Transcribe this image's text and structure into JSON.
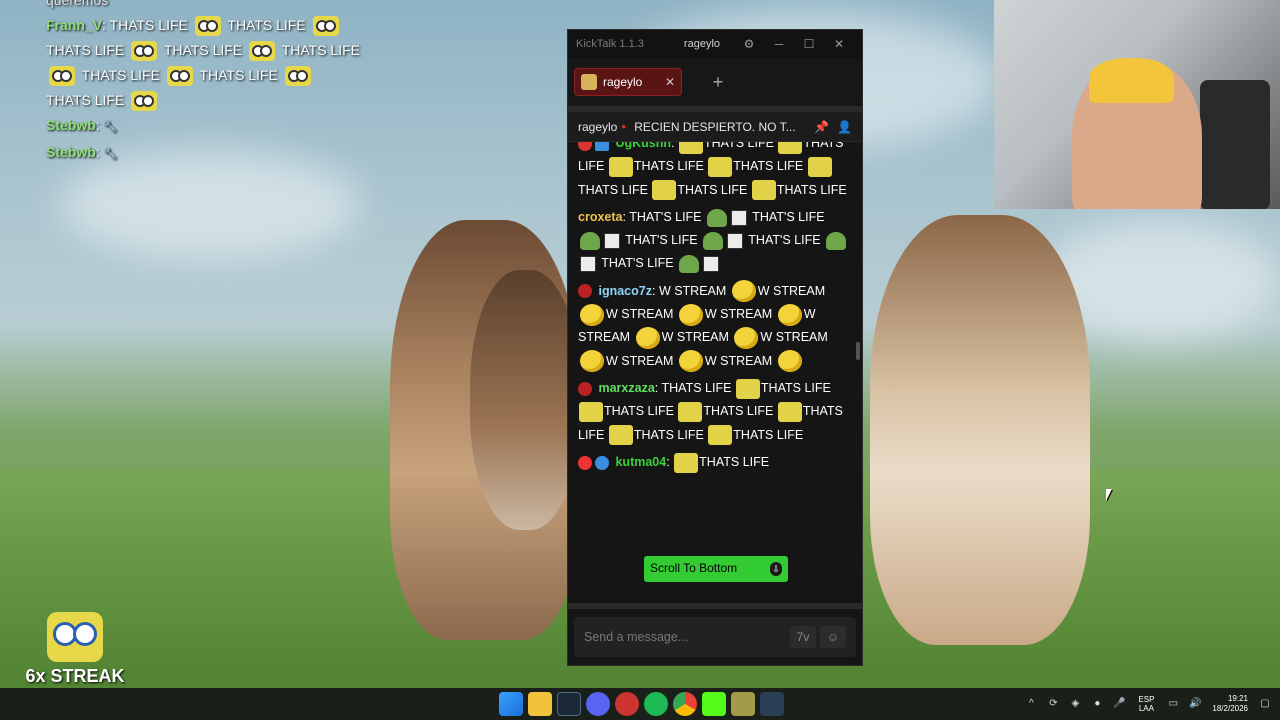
{
  "overlay_chat": {
    "top_partial": "queremos",
    "lines": [
      {
        "user": "Frann_V",
        "text": "THATS LIFE"
      },
      {
        "user": "Stebwb",
        "text": ""
      },
      {
        "user": "Stebwb",
        "text": ""
      }
    ],
    "repeat_text": "THATS LIFE"
  },
  "streak": {
    "label": "6x STREAK"
  },
  "kicktalk": {
    "app_title": "KickTalk 1.1.3",
    "username": "rageylo",
    "tab_label": "rageylo",
    "channel": "rageylo",
    "stream_title": "RECIEN DESPIERTO. NO T...",
    "messages": [
      {
        "user": "UgKushh",
        "color": "#3ad13a",
        "text": "THATS LIFE"
      },
      {
        "user": "croxeta",
        "color": "#f2c14e",
        "text": "THAT'S LIFE"
      },
      {
        "user": "ignaco7z",
        "color": "#8fd6ff",
        "text": "W STREAM"
      },
      {
        "user": "marxzaza",
        "color": "#5ee05e",
        "text": "THATS LIFE"
      },
      {
        "user": "kutma04",
        "color": "#3ad13a",
        "text": "THATS LIFE"
      }
    ],
    "scroll_button": "Scroll To Bottom",
    "input_placeholder": "Send a message..."
  },
  "taskbar": {
    "lang_top": "ESP",
    "lang_bottom": "LAA",
    "time": "19:21",
    "date": "18/2/2026"
  },
  "colors": {
    "accent_green": "#33cc33",
    "tab_red": "#5b1414"
  }
}
